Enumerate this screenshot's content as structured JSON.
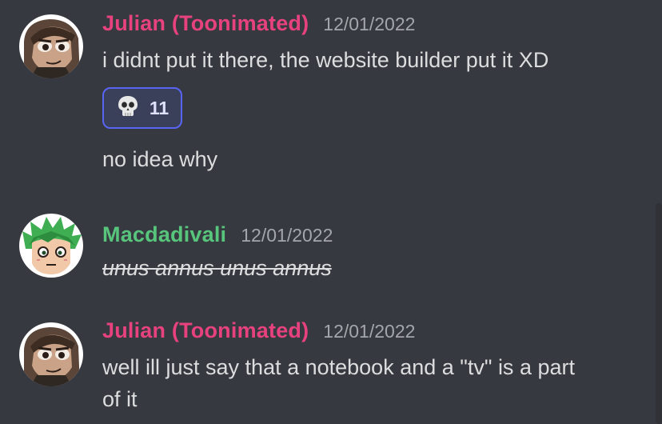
{
  "messages": [
    {
      "author": "Julian (Toonimated)",
      "author_color": "#e7427e",
      "timestamp": "12/01/2022",
      "lines": [
        "i didnt put it there, the website builder put it XD"
      ],
      "reaction": {
        "emoji": "skull-emoji",
        "count": "11"
      },
      "lines_after": [
        "no idea why"
      ]
    },
    {
      "author": "Macdadivali",
      "author_color": "#58c57c",
      "timestamp": "12/01/2022",
      "strike_text": "unus annus unus annus"
    },
    {
      "author": "Julian (Toonimated)",
      "author_color": "#e7427e",
      "timestamp": "12/01/2022",
      "lines": [
        "well ill just say that a notebook and a \"tv\" is a part",
        "of it"
      ]
    }
  ]
}
